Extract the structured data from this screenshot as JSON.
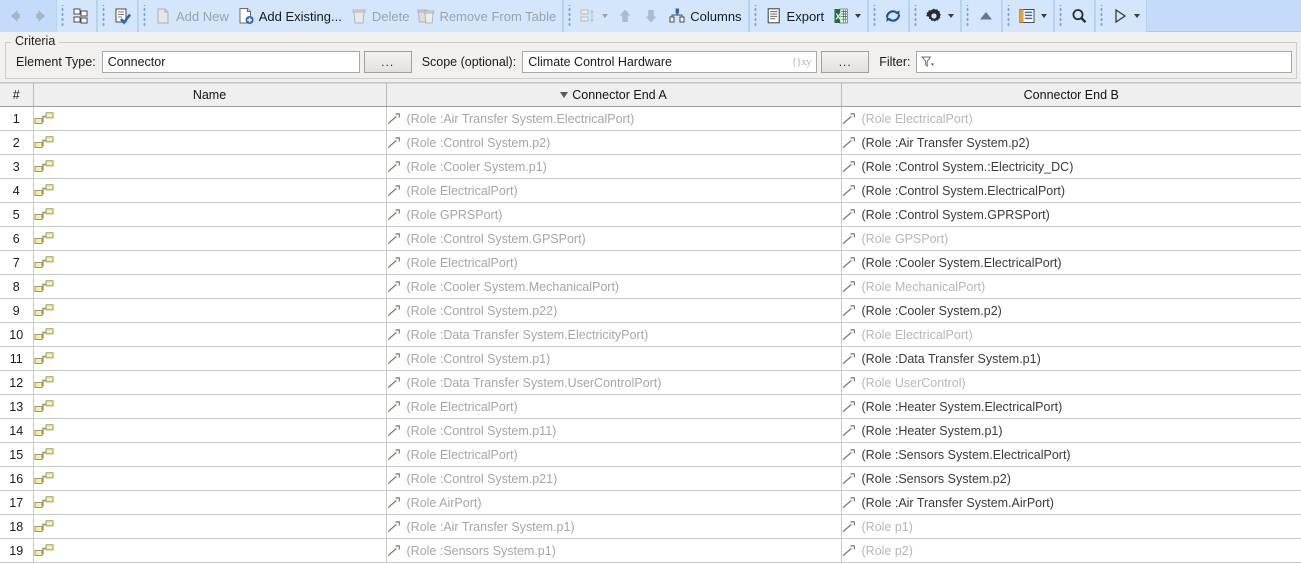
{
  "toolbar": {
    "groups": [
      {
        "items": [
          {
            "name": "back-button",
            "icon": "arrow-left-icon",
            "label": "",
            "enabled": false
          },
          {
            "name": "forward-button",
            "icon": "arrow-right-icon",
            "label": "",
            "enabled": false
          }
        ]
      },
      {
        "items": [
          {
            "name": "show-hierarchy-button",
            "icon": "hierarchy-icon",
            "label": "",
            "enabled": true
          }
        ]
      },
      {
        "items": [
          {
            "name": "validate-button",
            "icon": "validate-icon",
            "label": "",
            "enabled": true
          }
        ]
      },
      {
        "items": [
          {
            "name": "add-new-button",
            "icon": "new-document-icon",
            "label": "Add New",
            "enabled": false
          },
          {
            "name": "add-existing-button",
            "icon": "add-document-icon",
            "label": "Add Existing...",
            "enabled": true
          },
          {
            "name": "delete-button",
            "icon": "trash-icon",
            "label": "Delete",
            "enabled": false
          },
          {
            "name": "remove-from-table-button",
            "icon": "remove-trash-icon",
            "label": "Remove From Table",
            "enabled": false
          }
        ]
      },
      {
        "items": [
          {
            "name": "sort-button",
            "icon": "sort-icon",
            "label": "",
            "enabled": false,
            "caret": true
          },
          {
            "name": "move-up-button",
            "icon": "arrow-up-icon",
            "label": "",
            "enabled": false
          },
          {
            "name": "move-down-button",
            "icon": "arrow-down-icon",
            "label": "",
            "enabled": false
          },
          {
            "name": "columns-button",
            "icon": "columns-icon",
            "label": "Columns",
            "enabled": true
          }
        ]
      },
      {
        "items": [
          {
            "name": "export-button",
            "icon": "export-document-icon",
            "label": "Export",
            "enabled": true
          },
          {
            "name": "export-excel-button",
            "icon": "excel-icon",
            "label": "",
            "enabled": true,
            "caret": true
          }
        ]
      },
      {
        "items": [
          {
            "name": "refresh-button",
            "icon": "refresh-icon",
            "label": "",
            "enabled": true
          }
        ]
      },
      {
        "items": [
          {
            "name": "options-button",
            "icon": "gear-icon",
            "label": "",
            "enabled": true,
            "caret": true
          }
        ]
      },
      {
        "items": [
          {
            "name": "collapse-button",
            "icon": "triangle-up-icon",
            "label": "",
            "enabled": true
          }
        ]
      },
      {
        "items": [
          {
            "name": "legend-button",
            "icon": "list-icon",
            "label": "",
            "enabled": true,
            "caret": true
          }
        ]
      },
      {
        "items": [
          {
            "name": "search-button",
            "icon": "search-icon",
            "label": "",
            "enabled": true
          }
        ]
      },
      {
        "items": [
          {
            "name": "run-button",
            "icon": "play-icon",
            "label": "",
            "enabled": true,
            "caret": true
          }
        ]
      }
    ]
  },
  "criteria": {
    "legend": "Criteria",
    "element_type_label": "Element Type:",
    "element_type_value": "Connector",
    "element_type_browse_label": "...",
    "scope_label": "Scope (optional):",
    "scope_value": "Climate Control Hardware",
    "scope_xy_icon": "{}xy",
    "scope_browse_label": "...",
    "filter_label": "Filter:",
    "filter_value": ""
  },
  "table": {
    "columns": [
      {
        "key": "num",
        "label": "#",
        "sorted": false
      },
      {
        "key": "name",
        "label": "Name",
        "sorted": false
      },
      {
        "key": "enda",
        "label": "Connector End A",
        "sorted": true
      },
      {
        "key": "endb",
        "label": "Connector End B",
        "sorted": false
      }
    ],
    "rows": [
      {
        "num": "1",
        "name": "",
        "enda": "(Role :Air Transfer System.ElectricalPort)",
        "endb": "(Role ElectricalPort)",
        "endb_dim": true
      },
      {
        "num": "2",
        "name": "",
        "enda": "(Role :Control System.p2)",
        "endb": "(Role :Air Transfer System.p2)",
        "endb_dim": false
      },
      {
        "num": "3",
        "name": "",
        "enda": "(Role :Cooler System.p1)",
        "endb": "(Role :Control System.:Electricity_DC)",
        "endb_dim": false
      },
      {
        "num": "4",
        "name": "",
        "enda": "(Role ElectricalPort)",
        "endb": "(Role :Control System.ElectricalPort)",
        "endb_dim": false
      },
      {
        "num": "5",
        "name": "",
        "enda": "(Role GPRSPort)",
        "endb": "(Role :Control System.GPRSPort)",
        "endb_dim": false
      },
      {
        "num": "6",
        "name": "",
        "enda": "(Role :Control System.GPSPort)",
        "endb": "(Role GPSPort)",
        "endb_dim": true
      },
      {
        "num": "7",
        "name": "",
        "enda": "(Role ElectricalPort)",
        "endb": "(Role :Cooler System.ElectricalPort)",
        "endb_dim": false
      },
      {
        "num": "8",
        "name": "",
        "enda": "(Role :Cooler System.MechanicalPort)",
        "endb": "(Role MechanicalPort)",
        "endb_dim": true
      },
      {
        "num": "9",
        "name": "",
        "enda": "(Role :Control System.p22)",
        "endb": "(Role :Cooler System.p2)",
        "endb_dim": false
      },
      {
        "num": "10",
        "name": "",
        "enda": "(Role :Data Transfer System.ElectricityPort)",
        "endb": "(Role ElectricalPort)",
        "endb_dim": true
      },
      {
        "num": "11",
        "name": "",
        "enda": "(Role :Control System.p1)",
        "endb": "(Role :Data Transfer System.p1)",
        "endb_dim": false
      },
      {
        "num": "12",
        "name": "",
        "enda": "(Role :Data Transfer System.UserControlPort)",
        "endb": "(Role UserControl)",
        "endb_dim": true
      },
      {
        "num": "13",
        "name": "",
        "enda": "(Role ElectricalPort)",
        "endb": "(Role :Heater System.ElectricalPort)",
        "endb_dim": false
      },
      {
        "num": "14",
        "name": "",
        "enda": "(Role :Control System.p11)",
        "endb": "(Role :Heater System.p1)",
        "endb_dim": false
      },
      {
        "num": "15",
        "name": "",
        "enda": "(Role ElectricalPort)",
        "endb": "(Role :Sensors System.ElectricalPort)",
        "endb_dim": false
      },
      {
        "num": "16",
        "name": "",
        "enda": "(Role :Control System.p21)",
        "endb": "(Role :Sensors System.p2)",
        "endb_dim": false
      },
      {
        "num": "17",
        "name": "",
        "enda": "(Role AirPort)",
        "endb": "(Role :Air Transfer System.AirPort)",
        "endb_dim": false
      },
      {
        "num": "18",
        "name": "",
        "enda": "(Role :Air Transfer System.p1)",
        "endb": "(Role p1)",
        "endb_dim": true
      },
      {
        "num": "19",
        "name": "",
        "enda": "(Role :Sensors System.p1)",
        "endb": "(Role p2)",
        "endb_dim": true
      }
    ]
  },
  "colors": {
    "toolbar_bg": "#c4dcfa",
    "toolbar_group_bg": "#d3e6fb",
    "criteria_bg": "#f1f0ee",
    "header_bg": "#efefef",
    "grid_line": "#c9c9c9",
    "connector_yellow": "#f6f0a0",
    "text_dark": "#3a3a3a",
    "text_dim": "#b7b7b7"
  }
}
